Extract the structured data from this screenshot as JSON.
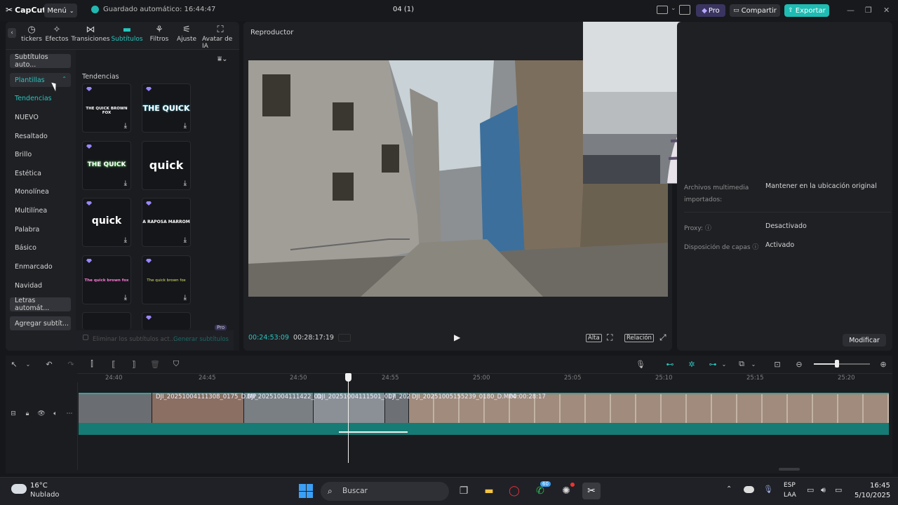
{
  "titlebar": {
    "app_name": "CapCut",
    "menu_label": "Menú",
    "autosave_text": "Guardado automático: 16:44:47",
    "project_title": "04 (1)",
    "pro_label": "Pro",
    "share_label": "Compartir",
    "export_label": "Exportar"
  },
  "tabs": [
    {
      "label": "Stickers",
      "shown": "tickers",
      "icon": "sticker-icon"
    },
    {
      "label": "Efectos",
      "icon": "effects-icon"
    },
    {
      "label": "Transiciones",
      "icon": "transitions-icon"
    },
    {
      "label": "Subtítulos",
      "icon": "captions-icon",
      "active": true
    },
    {
      "label": "Filtros",
      "icon": "filters-icon"
    },
    {
      "label": "Ajuste",
      "icon": "adjust-icon"
    },
    {
      "label": "Avatar de IA",
      "icon": "ai-avatar-icon"
    }
  ],
  "sidebar": {
    "items": [
      {
        "label": "Subtítulos auto...",
        "kind": "button"
      },
      {
        "label": "Plantillas",
        "kind": "active"
      },
      {
        "label": "Tendencias",
        "kind": "accent"
      },
      {
        "label": "NUEVO"
      },
      {
        "label": "Resaltado"
      },
      {
        "label": "Brillo"
      },
      {
        "label": "Estética"
      },
      {
        "label": "Monolínea"
      },
      {
        "label": "Multilínea"
      },
      {
        "label": "Palabra"
      },
      {
        "label": "Básico"
      },
      {
        "label": "Enmarcado"
      },
      {
        "label": "Navidad"
      },
      {
        "label": "Letras automát...",
        "kind": "button"
      },
      {
        "label": "Agregar subtít...",
        "kind": "button"
      }
    ]
  },
  "templates": {
    "section_title": "Tendencias",
    "cards": [
      {
        "text": "THE QUICK BROWN FOX"
      },
      {
        "text": "THE QUICK"
      },
      {
        "text": "THE QUICK"
      },
      {
        "text": "quick"
      },
      {
        "text": "quick"
      },
      {
        "text": "A RAPOSA MARROM"
      },
      {
        "text": "The quick brown fox"
      },
      {
        "text": "The quick brown fox"
      }
    ],
    "footer_text": "Eliminar los subtítulos act...",
    "footer_link": "Generar subtítulos",
    "footer_badge": "Pro"
  },
  "player": {
    "title": "Reproductor",
    "current_time": "00:24:53:09",
    "total_time": "00:28:17:19",
    "quality_label": "Alta",
    "ratio_label": "Relación"
  },
  "details": {
    "rows": [
      {
        "label": "Archivos multimedia importados:",
        "value": "Mantener en la ubicación original"
      },
      {
        "label": "Proxy:",
        "value": "Desactivado"
      },
      {
        "label": "Disposición de capas",
        "value": "Activado"
      }
    ],
    "modify_label": "Modificar"
  },
  "timeline": {
    "ticks": [
      "24:40",
      "24:45",
      "24:50",
      "24:55",
      "25:00",
      "25:05",
      "25:10",
      "25:15",
      "25:20"
    ],
    "clip_labels": [
      "DJI_20251004111308_0175_D.MP",
      "DJI_20251004111422_01",
      "DJI_20251004111501_017",
      "DJI_202",
      "DJI_20251005155239_0180_D.MP4",
      "00:00:28:17"
    ]
  },
  "taskbar": {
    "weather_temp": "16°C",
    "weather_desc": "Nublado",
    "search_placeholder": "Buscar",
    "whatsapp_badge": "60",
    "lang_top": "ESP",
    "lang_bottom": "LAA",
    "time": "16:45",
    "date": "5/10/2025"
  },
  "colors": {
    "accent": "#1fbcb3",
    "pro": "#9a86ff",
    "clip": "#1c8f87"
  }
}
